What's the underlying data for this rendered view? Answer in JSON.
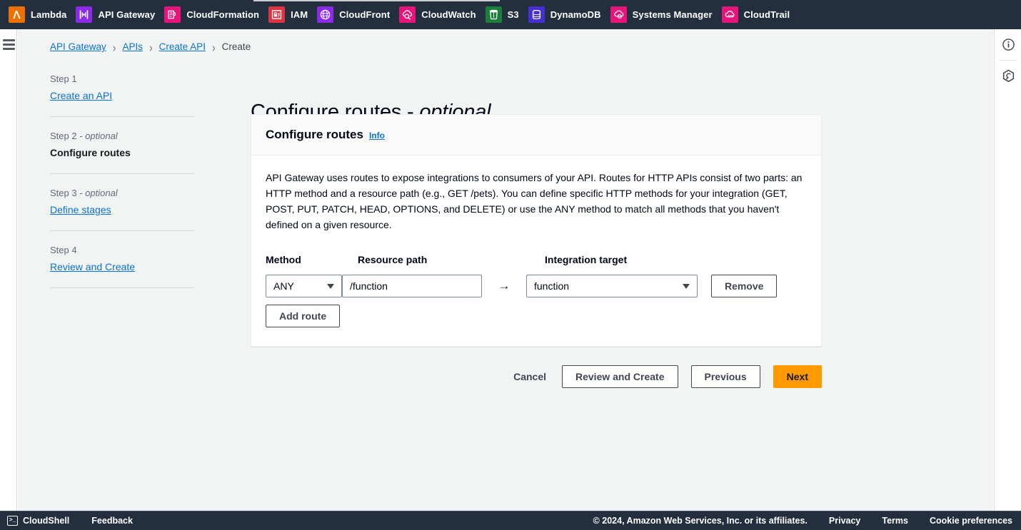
{
  "topbar": {
    "services": [
      {
        "label": "Lambda",
        "icon": "lambda-icon",
        "color": "#ed7100"
      },
      {
        "label": "API Gateway",
        "icon": "api-gateway-icon",
        "color": "#8c2ae8"
      },
      {
        "label": "CloudFormation",
        "icon": "cloudformation-icon",
        "color": "#e7157b"
      },
      {
        "label": "IAM",
        "icon": "iam-icon",
        "color": "#dd3444"
      },
      {
        "label": "CloudFront",
        "icon": "cloudfront-icon",
        "color": "#8c2ae8"
      },
      {
        "label": "CloudWatch",
        "icon": "cloudwatch-icon",
        "color": "#e7157b"
      },
      {
        "label": "S3",
        "icon": "s3-icon",
        "color": "#1b7f3b"
      },
      {
        "label": "DynamoDB",
        "icon": "dynamodb-icon",
        "color": "#4430d6"
      },
      {
        "label": "Systems Manager",
        "icon": "systems-manager-icon",
        "color": "#e7157b"
      },
      {
        "label": "CloudTrail",
        "icon": "cloudtrail-icon",
        "color": "#e7157b"
      }
    ]
  },
  "breadcrumb": {
    "items": [
      {
        "label": "API Gateway",
        "current": false
      },
      {
        "label": "APIs",
        "current": false
      },
      {
        "label": "Create API",
        "current": false
      },
      {
        "label": "Create",
        "current": true
      }
    ],
    "separator": "›"
  },
  "steps": [
    {
      "kicker": "Step 1",
      "optional": "",
      "label": "Create an API",
      "active": false
    },
    {
      "kicker": "Step 2",
      "optional": " - optional",
      "label": "Configure routes",
      "active": true
    },
    {
      "kicker": "Step 3",
      "optional": " - optional",
      "label": "Define stages",
      "active": false
    },
    {
      "kicker": "Step 4",
      "optional": "",
      "label": "Review and Create",
      "active": false
    }
  ],
  "page": {
    "title_main": "Configure routes",
    "title_dash": " - ",
    "title_optional": "optional"
  },
  "card": {
    "header_title": "Configure routes",
    "info_label": "Info",
    "description": "API Gateway uses routes to expose integrations to consumers of your API. Routes for HTTP APIs consist of two parts: an HTTP method and a resource path (e.g., GET /pets). You can define specific HTTP methods for your integration (GET, POST, PUT, PATCH, HEAD, OPTIONS, and DELETE) or use the ANY method to match all methods that you haven't defined on a given resource."
  },
  "form": {
    "labels": {
      "method": "Method",
      "resource_path": "Resource path",
      "integration_target": "Integration target"
    },
    "method_value": "ANY",
    "resource_path_value": "/function",
    "resource_path_placeholder": "/function",
    "integration_target_value": "function",
    "arrow_glyph": "→",
    "remove_label": "Remove",
    "add_route_label": "Add route"
  },
  "actions": {
    "cancel": "Cancel",
    "review_and_create": "Review and Create",
    "previous": "Previous",
    "next": "Next",
    "next_color": "#ff9900"
  },
  "right_rail": {
    "info_icon": "info-circle-icon",
    "settings_icon": "hexagon-settings-icon"
  },
  "bottombar": {
    "cloudshell": "CloudShell",
    "cloudshell_glyph": ">_",
    "feedback": "Feedback",
    "copyright": "© 2024, Amazon Web Services, Inc. or its affiliates.",
    "links": [
      "Privacy",
      "Terms",
      "Cookie preferences"
    ]
  }
}
